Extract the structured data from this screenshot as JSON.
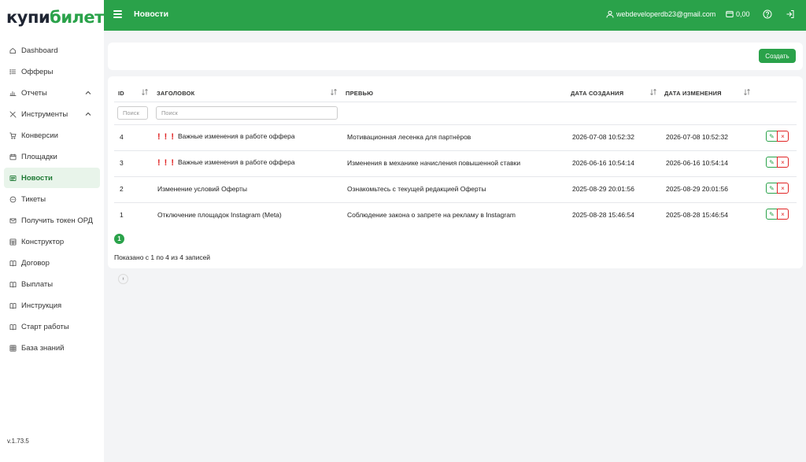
{
  "logo": {
    "part1": "купи",
    "part2": "билет"
  },
  "sidebar": {
    "items": [
      {
        "label": "Dashboard",
        "icon": "home-icon"
      },
      {
        "label": "Офферы",
        "icon": "list-icon"
      },
      {
        "label": "Отчеты",
        "icon": "bar-chart-icon",
        "expanded": true
      },
      {
        "label": "Инструменты",
        "icon": "tools-icon",
        "expanded": true
      },
      {
        "label": "Конверсии",
        "icon": "cart-icon"
      },
      {
        "label": "Площадки",
        "icon": "calendar-icon"
      },
      {
        "label": "Новости",
        "icon": "newspaper-icon",
        "active": true
      },
      {
        "label": "Тикеты",
        "icon": "chat-icon"
      },
      {
        "label": "Получить токен ОРД",
        "icon": "mail-icon"
      },
      {
        "label": "Конструктор",
        "icon": "grid-icon"
      },
      {
        "label": "Договор",
        "icon": "book-icon"
      },
      {
        "label": "Выплаты",
        "icon": "book-icon"
      },
      {
        "label": "Инструкция",
        "icon": "book-icon"
      },
      {
        "label": "Старт работы",
        "icon": "book-icon"
      },
      {
        "label": "База знаний",
        "icon": "table-icon"
      }
    ],
    "version": "v.1.73.5"
  },
  "header": {
    "title": "Новости",
    "user_email": "webdeveloperdb23@gmail.com",
    "balance": "0,00"
  },
  "toolbar": {
    "create_label": "Создать"
  },
  "table": {
    "columns": {
      "id": "ID",
      "title": "ЗАГОЛОВОК",
      "preview": "ПРЕВЬЮ",
      "created": "ДАТА СОЗДАНИЯ",
      "updated": "ДАТА ИЗМЕНЕНИЯ"
    },
    "filters": {
      "id_placeholder": "Поиск",
      "title_placeholder": "Поиск"
    },
    "rows": [
      {
        "id": "4",
        "important": true,
        "title": "Важные изменения в работе оффера",
        "preview": "Мотивационная лесенка для партнёров",
        "created": "2026-07-08 10:52:32",
        "updated": "2026-07-08 10:52:32"
      },
      {
        "id": "3",
        "important": true,
        "title": "Важные изменения в работе оффера",
        "preview": "Изменения в механике начисления повышенной ставки",
        "created": "2026-06-16 10:54:14",
        "updated": "2026-06-16 10:54:14"
      },
      {
        "id": "2",
        "important": false,
        "title": "Изменение условий Оферты",
        "preview": "Ознакомьтесь с текущей редакцией Оферты",
        "created": "2025-08-29 20:01:56",
        "updated": "2025-08-29 20:01:56"
      },
      {
        "id": "1",
        "important": false,
        "title": "Отключение площадок Instagram (Meta)",
        "preview": "Соблюдение закона о запрете на рекламу в Instagram",
        "created": "2025-08-28 15:46:54",
        "updated": "2025-08-28 15:46:54"
      }
    ],
    "exclamation": "!",
    "edit_glyph": "✎",
    "delete_glyph": "×",
    "pagination": {
      "prev": "‹",
      "current": "1",
      "next": "›"
    },
    "summary": "Показано с 1 по 4 из 4 записей"
  },
  "colors": {
    "brand_green": "#2aa24a",
    "danger_red": "#e02424",
    "active_bg": "#e8f4ea"
  }
}
